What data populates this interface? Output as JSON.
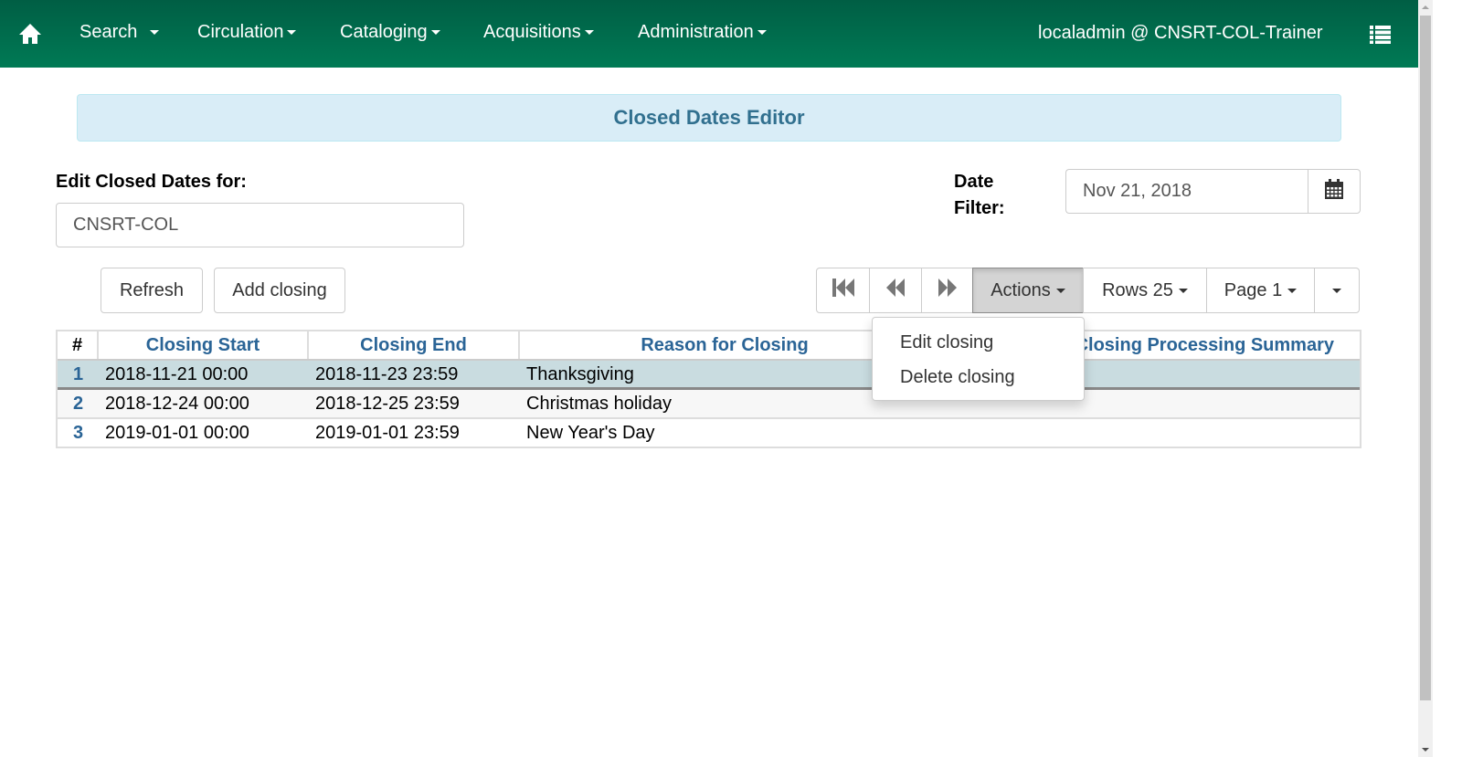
{
  "navbar": {
    "home_icon": "home-icon",
    "items": [
      {
        "label": "Search"
      },
      {
        "label": "Circulation"
      },
      {
        "label": "Cataloging"
      },
      {
        "label": "Acquisitions"
      },
      {
        "label": "Administration"
      }
    ],
    "user_label": "localadmin @ CNSRT-COL-Trainer",
    "menu_icon": "list-icon",
    "bg_color": "#006b4b"
  },
  "page": {
    "title": "Closed Dates Editor",
    "edit_for_label": "Edit Closed Dates for:",
    "org_value": "CNSRT-COL",
    "date_filter_label_1": "Date",
    "date_filter_label_2": "Filter:",
    "date_filter_value": "Nov 21, 2018",
    "calendar_icon": "calendar-icon"
  },
  "buttons": {
    "refresh": "Refresh",
    "add_closing": "Add closing"
  },
  "toolbar": {
    "first_icon": "first-page-icon",
    "prev_icon": "previous-page-icon",
    "next_icon": "next-page-icon",
    "actions": "Actions",
    "rows": "Rows 25",
    "page": "Page 1"
  },
  "actions_menu": {
    "items": [
      {
        "label": "Edit closing"
      },
      {
        "label": "Delete closing"
      }
    ]
  },
  "grid": {
    "columns": [
      "#",
      "Closing Start",
      "Closing End",
      "Reason for Closing",
      "Closing Processing Summary"
    ],
    "rows": [
      {
        "num": "1",
        "start": "2018-11-21 00:00",
        "end": "2018-11-23 23:59",
        "reason": "Thanksgiving",
        "summary": "",
        "selected": true
      },
      {
        "num": "2",
        "start": "2018-12-24 00:00",
        "end": "2018-12-25 23:59",
        "reason": "Christmas holiday",
        "summary": ""
      },
      {
        "num": "3",
        "start": "2019-01-01 00:00",
        "end": "2019-01-01 23:59",
        "reason": "New Year's Day",
        "summary": ""
      }
    ]
  }
}
